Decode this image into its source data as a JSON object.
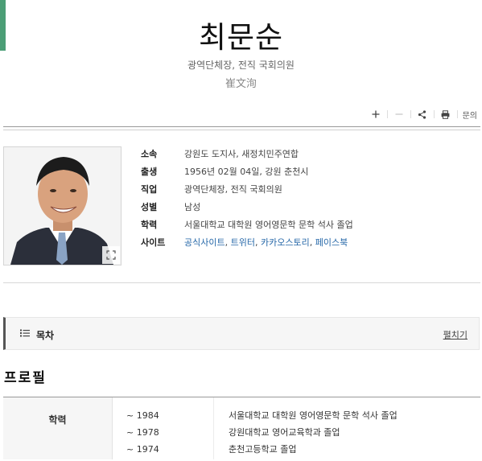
{
  "header": {
    "title": "최문순",
    "subtitle": "광역단체장, 전직 국회의원",
    "hanja": "崔文洵"
  },
  "toolbar": {
    "plus_icon": "plus-icon",
    "minus_icon": "minus-icon",
    "share_icon": "share-icon",
    "print_icon": "print-icon",
    "report_label": "문의"
  },
  "infobox": {
    "rows": [
      {
        "key": "소속",
        "value": "강원도 도지사, 새정치민주연합"
      },
      {
        "key": "출생",
        "value": "1956년 02월 04일, 강원 춘천시"
      },
      {
        "key": "직업",
        "value": "광역단체장, 전직 국회의원"
      },
      {
        "key": "성별",
        "value": "남성"
      },
      {
        "key": "학력",
        "value": "서울대학교 대학원 영어영문학 문학 석사 졸업"
      }
    ],
    "site_key": "사이트",
    "sites": [
      "공식사이트",
      "트위터",
      "카카오스토리",
      "페이스북"
    ],
    "separator": ", "
  },
  "toc": {
    "title": "목차",
    "expand_label": "펼치기"
  },
  "profile": {
    "section_title": "프로필",
    "category": "학력",
    "entries": [
      {
        "year": "~ 1984",
        "detail": "서울대학교 대학원 영어영문학 문학 석사 졸업"
      },
      {
        "year": "~ 1978",
        "detail": "강원대학교 영어교육학과 졸업"
      },
      {
        "year": "~ 1974",
        "detail": "춘천고등학교 졸업"
      }
    ]
  },
  "colors": {
    "accent": "#4b9e76",
    "link": "#2567a8"
  }
}
